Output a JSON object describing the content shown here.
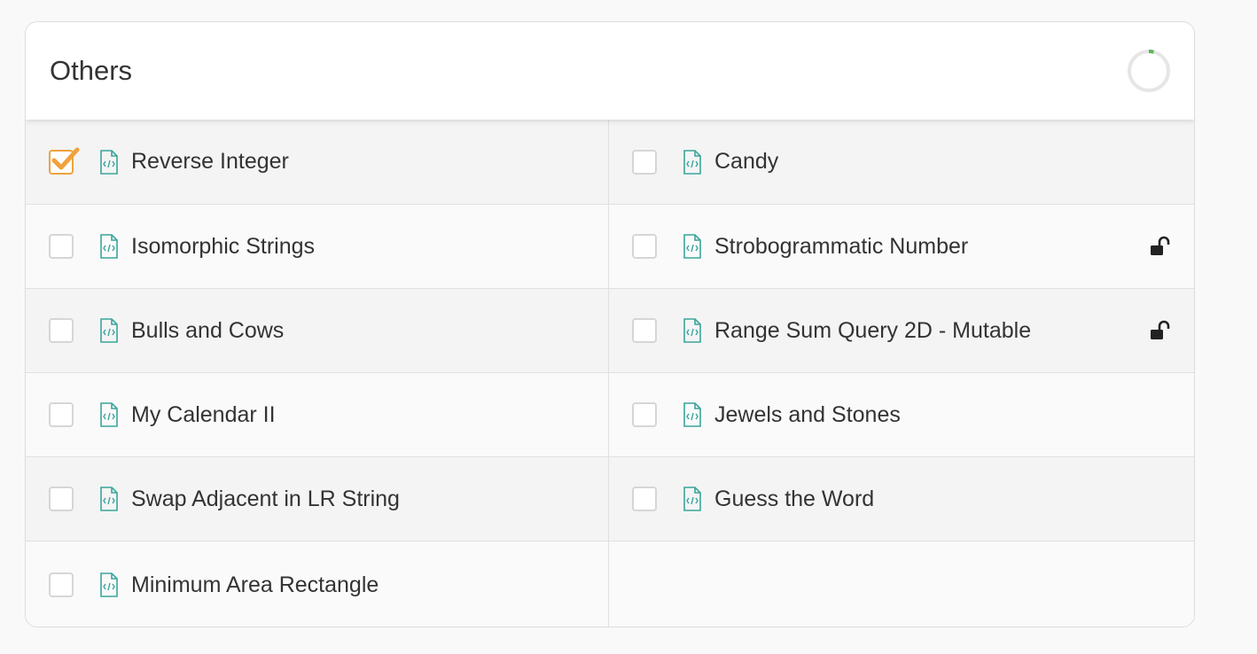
{
  "section": {
    "title": "Others",
    "progress": {
      "fraction": 0.04,
      "color": "#5cb85c"
    }
  },
  "problems": [
    {
      "label": "Reverse Integer",
      "checked": true,
      "locked": false
    },
    {
      "label": "Candy",
      "checked": false,
      "locked": false
    },
    {
      "label": "Isomorphic Strings",
      "checked": false,
      "locked": false
    },
    {
      "label": "Strobogrammatic Number",
      "checked": false,
      "locked": true
    },
    {
      "label": "Bulls and Cows",
      "checked": false,
      "locked": false
    },
    {
      "label": "Range Sum Query 2D - Mutable",
      "checked": false,
      "locked": true
    },
    {
      "label": "My Calendar II",
      "checked": false,
      "locked": false
    },
    {
      "label": "Jewels and Stones",
      "checked": false,
      "locked": false
    },
    {
      "label": "Swap Adjacent in LR String",
      "checked": false,
      "locked": false
    },
    {
      "label": "Guess the Word",
      "checked": false,
      "locked": false
    },
    {
      "label": "Minimum Area Rectangle",
      "checked": false,
      "locked": false
    }
  ],
  "icons": {
    "file": "file-code-icon",
    "lock": "unlock-icon",
    "check": "checkmark-icon"
  },
  "colors": {
    "accent_check": "#f0a23c",
    "file_icon": "#3aa59a"
  }
}
